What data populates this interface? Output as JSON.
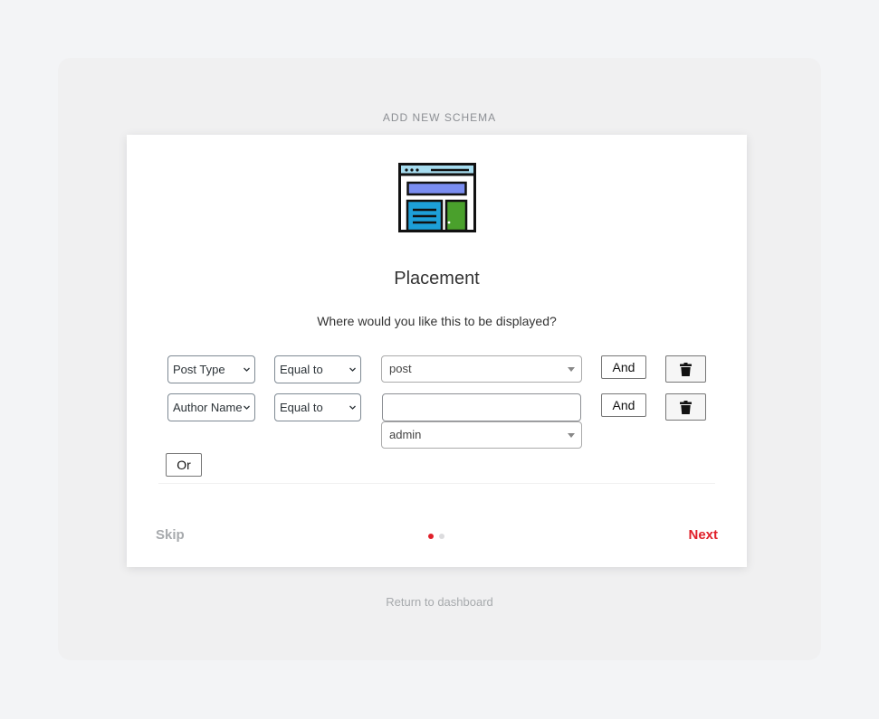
{
  "page": {
    "heading": "ADD NEW SCHEMA",
    "return_link": "Return to dashboard"
  },
  "card": {
    "illustration_icon": "web-page-layout-icon",
    "title": "Placement",
    "subtitle": "Where would you like this to be displayed?"
  },
  "rules": [
    {
      "field": "Post Type",
      "operator": "Equal to",
      "value": "post",
      "search_value": "",
      "and_label": "And",
      "delete_icon": "trash-icon"
    },
    {
      "field": "Author Name",
      "operator": "Equal to",
      "value": "admin",
      "search_value": "",
      "and_label": "And",
      "delete_icon": "trash-icon"
    }
  ],
  "or_label": "Or",
  "footer": {
    "skip_label": "Skip",
    "next_label": "Next",
    "steps_total": 2,
    "current_step": 1
  },
  "colors": {
    "accent": "#e0202a",
    "muted": "#a7aaad",
    "dot_inactive": "#dcdcde"
  }
}
